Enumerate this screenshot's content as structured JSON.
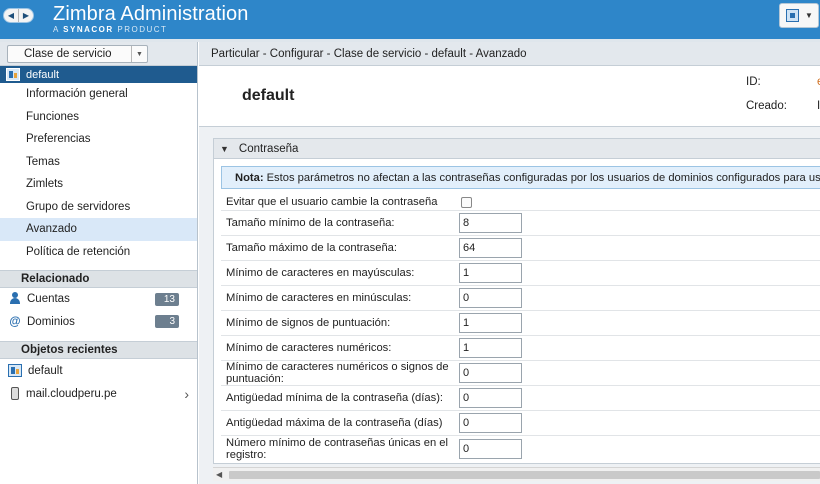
{
  "topbar": {
    "brand_title": "Zimbra Administration",
    "brand_sub_prefix": "A",
    "brand_sub_company": "SYNACOR",
    "brand_sub_suffix": "PRODUCT",
    "back_icon": "chevron-left-icon",
    "forward_icon": "chevron-right-icon"
  },
  "sidebar": {
    "section_select": "Clase de servicio",
    "root_item": "default",
    "items": [
      {
        "label": "Información general"
      },
      {
        "label": "Funciones"
      },
      {
        "label": "Preferencias"
      },
      {
        "label": "Temas"
      },
      {
        "label": "Zimlets"
      },
      {
        "label": "Grupo de servidores"
      },
      {
        "label": "Avanzado",
        "active": true
      },
      {
        "label": "Política de retención"
      }
    ],
    "related_header": "Relacionado",
    "related": [
      {
        "label": "Cuentas",
        "count": "13",
        "icon": "user-icon"
      },
      {
        "label": "Dominios",
        "count": "3",
        "icon": "at-icon"
      }
    ],
    "recent_header": "Objetos recientes",
    "recent": [
      {
        "label": "default",
        "icon": "cos-icon"
      },
      {
        "label": "mail.cloudperu.pe",
        "icon": "server-icon"
      }
    ]
  },
  "main": {
    "breadcrumb": "Particular - Configurar - Clase de servicio - default - Avanzado",
    "title": "default",
    "id_label": "ID:",
    "id_value": "e",
    "created_label": "Creado:",
    "created_value": "I",
    "group_title": "Contraseña",
    "note_bold": "Nota:",
    "note_text": "Estos parámetros no afectan a las contraseñas configuradas por los usuarios de dominios configurados para usar",
    "fields": [
      {
        "label": "Evitar que el usuario cambie la contraseña",
        "type": "checkbox",
        "checked": false
      },
      {
        "label": "Tamaño mínimo de la contraseña:",
        "type": "text",
        "value": "8"
      },
      {
        "label": "Tamaño máximo de la contraseña:",
        "type": "text",
        "value": "64"
      },
      {
        "label": "Mínimo de caracteres en mayúsculas:",
        "type": "text",
        "value": "1"
      },
      {
        "label": "Mínimo de caracteres en minúsculas:",
        "type": "text",
        "value": "0"
      },
      {
        "label": "Mínimo de signos de puntuación:",
        "type": "text",
        "value": "1"
      },
      {
        "label": "Mínimo de caracteres numéricos:",
        "type": "text",
        "value": "1"
      },
      {
        "label": "Mínimo de caracteres numéricos o signos de puntuación:",
        "type": "text",
        "value": "0"
      },
      {
        "label": "Antigüedad mínima de la contraseña (días):",
        "type": "text",
        "value": "0"
      },
      {
        "label": "Antigüedad máxima de la contraseña (días)",
        "type": "text",
        "value": "0"
      },
      {
        "label": "Número mínimo de contraseñas únicas en el registro:",
        "type": "text",
        "value": "0"
      }
    ]
  }
}
